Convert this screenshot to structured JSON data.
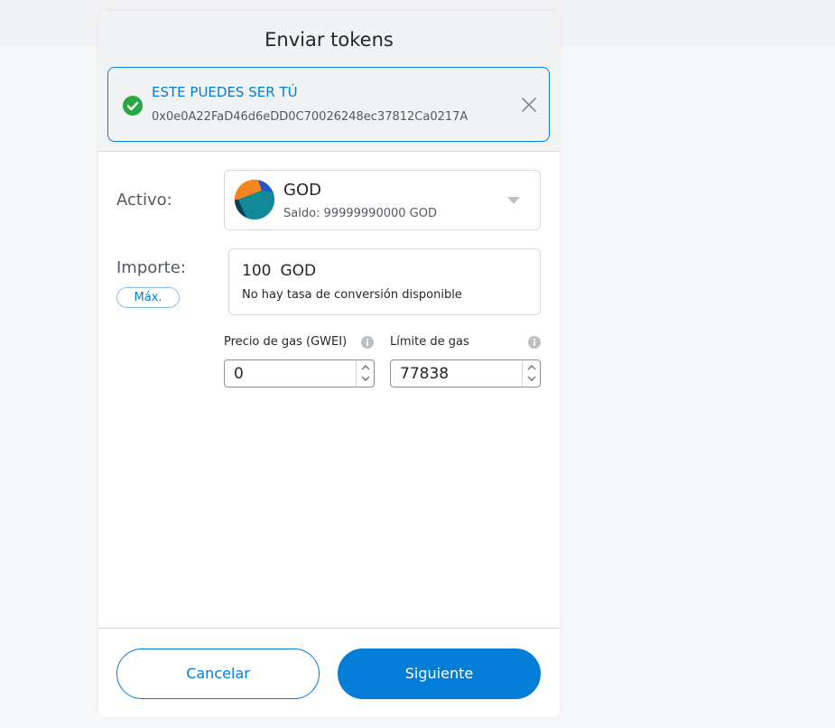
{
  "header": {
    "title": "Enviar tokens"
  },
  "recipient": {
    "name": "ESTE PUEDES SER TÚ",
    "address": "0x0e0A22FaD46d6eDD0C70026248ec37812Ca0217A"
  },
  "asset": {
    "label": "Activo:",
    "token_symbol": "GOD",
    "balance": "Saldo: 99999990000 GOD"
  },
  "amount": {
    "label": "Importe:",
    "max_label": "Máx.",
    "value": "100",
    "unit": "GOD",
    "conversion": "No hay tasa de conversión disponible"
  },
  "gas": {
    "price_label": "Precio de gas (GWEI)",
    "price_value": "0",
    "limit_label": "Límite de gas",
    "limit_value": "77838"
  },
  "footer": {
    "cancel_label": "Cancelar",
    "next_label": "Siguiente"
  },
  "colors": {
    "accent": "#037dd6",
    "success": "#28a745",
    "header_bg": "#f2f3f4"
  },
  "icons": {
    "check": "check-circle-icon",
    "close": "close-icon",
    "token": "token-icon",
    "caret": "caret-down-icon",
    "info": "info-icon"
  }
}
